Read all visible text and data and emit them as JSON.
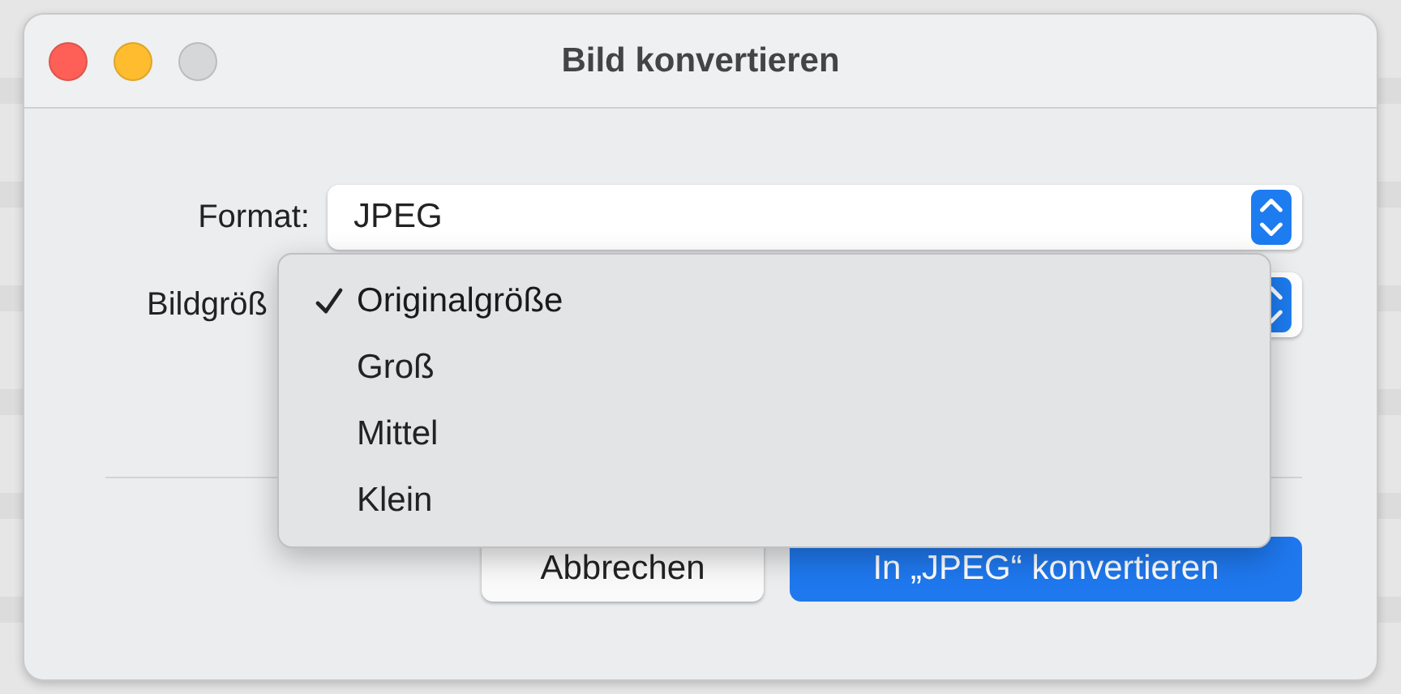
{
  "window": {
    "title": "Bild konvertieren"
  },
  "form": [
    {
      "label": "Format:",
      "value": "JPEG"
    },
    {
      "label": "Bildgröß"
    }
  ],
  "menu": {
    "items": [
      {
        "label": "Originalgröße",
        "selected": true
      },
      {
        "label": "Groß",
        "selected": false
      },
      {
        "label": "Mittel",
        "selected": false
      },
      {
        "label": "Klein",
        "selected": false
      }
    ]
  },
  "buttons": [
    {
      "label": "Abbrechen",
      "kind": "secondary"
    },
    {
      "label": "In „JPEG“ konvertieren",
      "kind": "primary"
    }
  ]
}
